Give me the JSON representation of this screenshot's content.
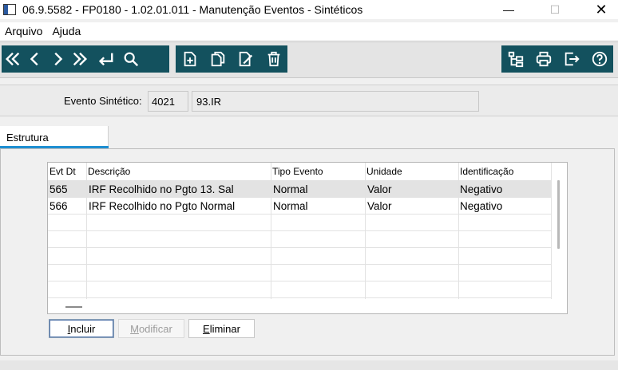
{
  "window": {
    "title": "06.9.5582 - FP0180 - 1.02.01.011 - Manutenção Eventos - Sintéticos",
    "minimize_glyph": "—",
    "maximize_glyph": "☐",
    "close_glyph": "✕"
  },
  "menu": {
    "items": [
      "Arquivo",
      "Ajuda"
    ]
  },
  "toolbar": {
    "nav_buttons": [
      "first-icon",
      "previous-icon",
      "next-icon",
      "last-icon",
      "enter-icon",
      "search-icon"
    ],
    "record_buttons": [
      "new-icon",
      "copy-icon",
      "edit-icon",
      "delete-icon"
    ],
    "right_buttons": [
      "tree-icon",
      "print-icon",
      "exit-icon",
      "help-icon"
    ],
    "accent_color": "#13515e"
  },
  "header": {
    "label": "Evento Sintético:",
    "code": "4021",
    "description": "93.IR"
  },
  "tabs": [
    {
      "label": "Estrutura",
      "active": true
    }
  ],
  "grid": {
    "columns": [
      "Evt Dt",
      "Descrição",
      "Tipo Evento",
      "Unidade",
      "Identificação"
    ],
    "rows": [
      {
        "evt": "565",
        "descricao": "IRF Recolhido no Pgto 13. Sal",
        "tipo": "Normal",
        "unidade": "Valor",
        "identificacao": "Negativo"
      },
      {
        "evt": "566",
        "descricao": "IRF Recolhido no Pgto Normal",
        "tipo": "Normal",
        "unidade": "Valor",
        "identificacao": "Negativo"
      }
    ]
  },
  "buttons": {
    "incluir": {
      "mnemonic": "I",
      "rest": "ncluir"
    },
    "modificar": {
      "mnemonic": "M",
      "rest": "odificar"
    },
    "eliminar": {
      "mnemonic": "E",
      "rest": "liminar"
    }
  }
}
